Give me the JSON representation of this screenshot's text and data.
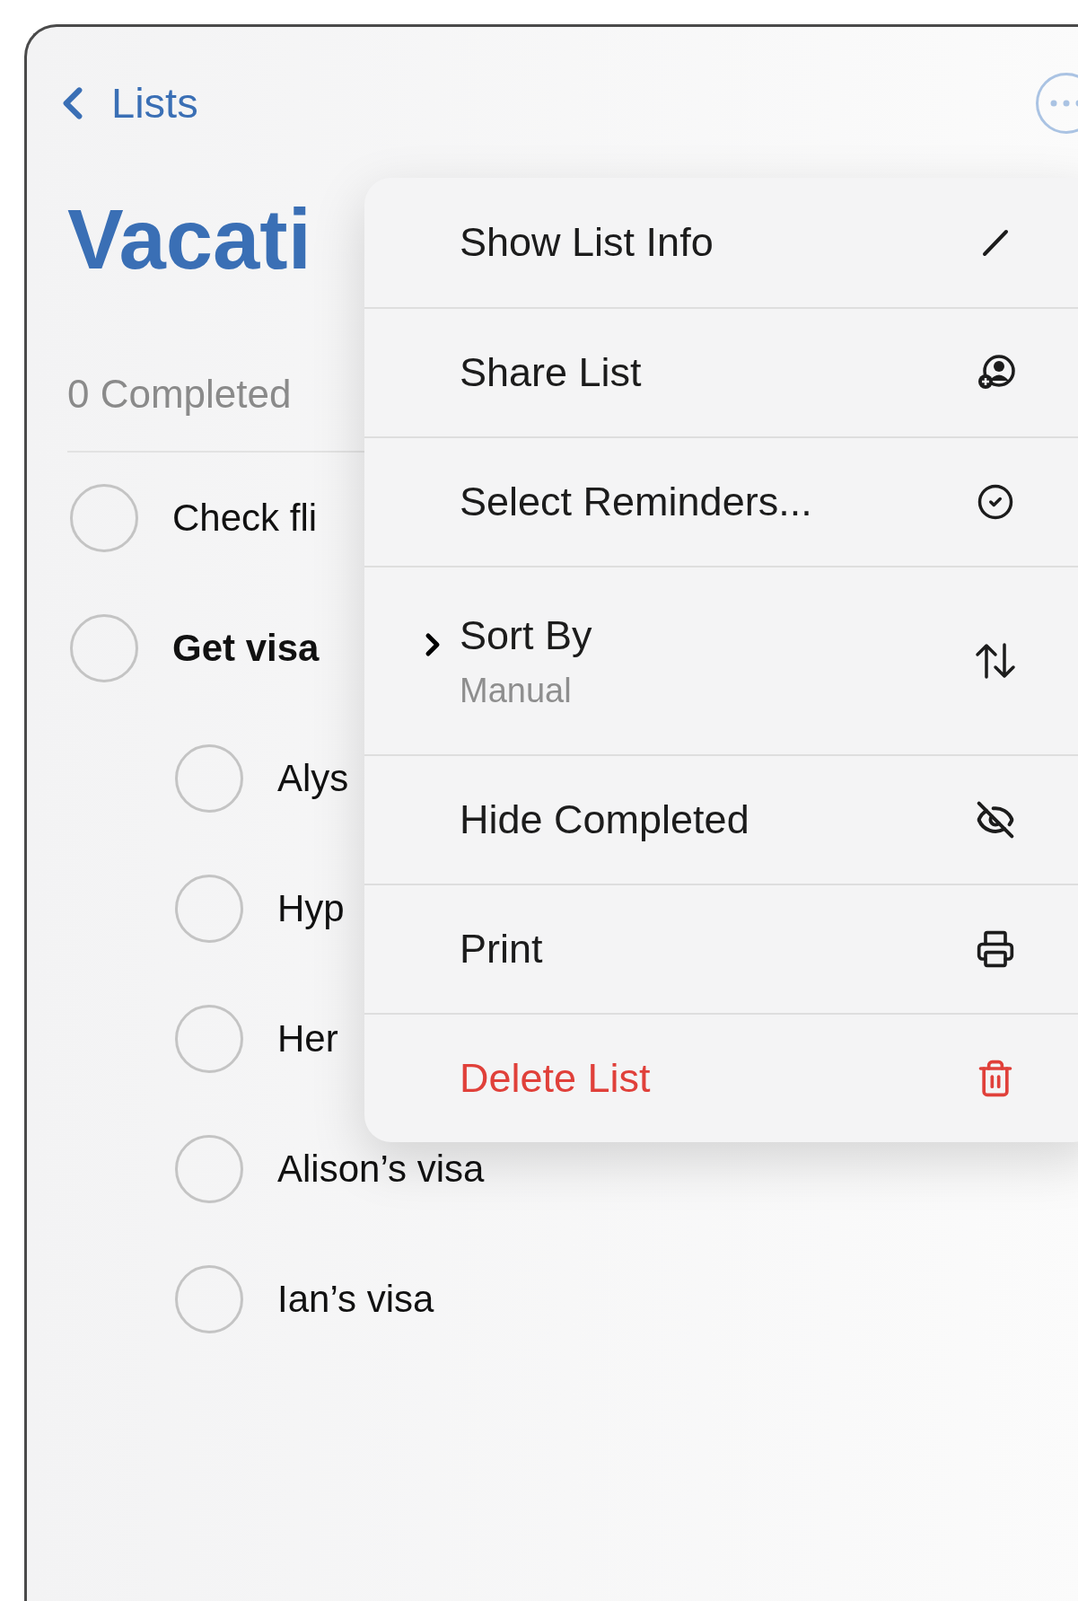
{
  "nav": {
    "back_label": "Lists"
  },
  "title": "Vacati",
  "completed_count": "0 Completed",
  "reminders": [
    {
      "text": "Check fli",
      "checked": false
    },
    {
      "text": "Get visa",
      "checked": false,
      "children": [
        {
          "text": "Alys",
          "checked": false
        },
        {
          "text": "Hyp",
          "checked": false
        },
        {
          "text": "Her",
          "checked": false
        },
        {
          "text": "Alison’s visa",
          "checked": false
        },
        {
          "text": "Ian’s visa",
          "checked": false
        }
      ]
    }
  ],
  "menu": [
    {
      "label": "Show List Info",
      "destructive": false
    },
    {
      "label": "Share List",
      "destructive": false
    },
    {
      "label": "Select Reminders...",
      "destructive": false
    },
    {
      "label": "Sort By",
      "subtitle": "Manual",
      "submenu": true,
      "destructive": false
    },
    {
      "label": "Hide Completed",
      "destructive": false
    },
    {
      "label": "Print",
      "destructive": false
    },
    {
      "label": "Delete List",
      "destructive": true
    }
  ]
}
